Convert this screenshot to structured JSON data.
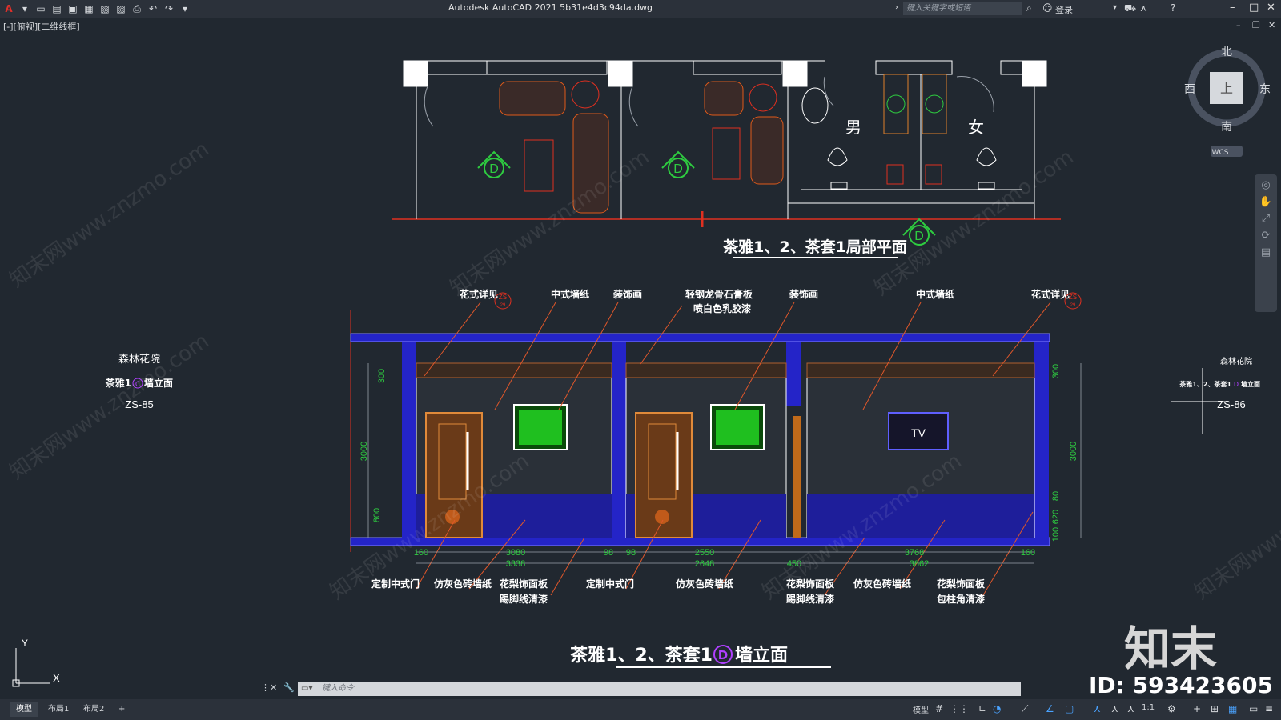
{
  "titlebar": {
    "app_title": "Autodesk AutoCAD 2021    5b31e4d3c94da.dwg",
    "search_placeholder": "键入关键字或短语",
    "login_label": "登录"
  },
  "viewport_label": "[-][俯视][二维线框]",
  "compass": {
    "north": "北",
    "south": "南",
    "east": "东",
    "west": "西",
    "top": "上",
    "wcs": "WCS"
  },
  "drawing": {
    "plan_title": "茶雅1、2、茶套1局部平面",
    "plan_male": "男",
    "plan_female": "女",
    "elev_title": "茶雅1、2、茶套1",
    "elev_title_circle": "D",
    "elev_title_suffix": "墙立面",
    "section_marker": "D",
    "top_callouts": [
      "花式详见",
      "中式墙纸",
      "装饰画",
      "轻钢龙骨石膏板",
      "喷白色乳胶漆",
      "装饰画",
      "中式墙纸",
      "花式详见"
    ],
    "zs_ref": "ZS",
    "zs_ref_num": "29",
    "bottom_callouts": [
      "定制中式门",
      "仿灰色砖墙纸",
      "花梨饰面板",
      "踢脚线清漆",
      "定制中式门",
      "仿灰色砖墙纸",
      "花梨饰面板",
      "踢脚线清漆",
      "仿灰色砖墙纸",
      "花梨饰面板",
      "包柱角清漆"
    ],
    "dims_bottom_row1": [
      "160",
      "3080",
      "98",
      "98",
      "2550",
      "3768",
      "160"
    ],
    "dims_bottom_row2": [
      "3338",
      "2648",
      "450",
      "3862"
    ],
    "dims_left": [
      "300",
      "3000",
      "800"
    ],
    "dims_right": [
      "300",
      "3000",
      "80",
      "620",
      "100"
    ],
    "tv_label": "TV",
    "left_block": {
      "line1": "森林花院",
      "line2": "茶雅1",
      "line2_circle": "C",
      "line2_suffix": "墙立面",
      "line3": "ZS-85"
    },
    "right_block": {
      "line1": "森林花院",
      "line2": "茶雅1、2、茶套1",
      "line2_circle": "D",
      "line2_suffix": "墙立面",
      "line3": "ZS-86"
    },
    "ucs_x": "X",
    "ucs_y": "Y"
  },
  "watermark": {
    "brand": "知末",
    "id": "ID: 593423605",
    "tile_text": "知末网www.znzmo.com"
  },
  "command": {
    "placeholder": "键入命令"
  },
  "statusbar": {
    "tabs": [
      "模型",
      "布局1",
      "布局2",
      "+"
    ],
    "model_label": "模型",
    "scale": "1:1"
  },
  "colors": {
    "background": "#212830",
    "wall_blue": "#2424c8",
    "line_white": "#ffffff",
    "line_red": "#e03020",
    "dim_green": "#2ecc40",
    "leader_orange": "#e0572a",
    "wood_brown": "#8a4a18"
  }
}
